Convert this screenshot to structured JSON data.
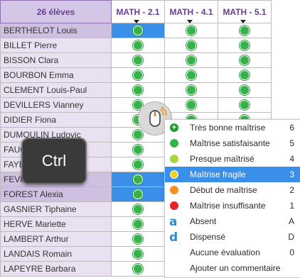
{
  "header": {
    "students_label": "26 élèves",
    "columns": [
      "MATH - 2.1",
      "MATH - 4.1",
      "MATH - 5.1"
    ]
  },
  "students": [
    "BERTHELOT Louis",
    "BILLET Pierre",
    "BISSON Clara",
    "BOURBON Emma",
    "CLEMENT Louis-Paul",
    "DEVILLERS Vianney",
    "DIDIER Fiona",
    "DUMOULIN Ludovic",
    "FAUC",
    "FAYE",
    "FEVR",
    "FOREST Alexia",
    "GASNIER Tiphaine",
    "HERVE Mariette",
    "LAMBERT Arthur",
    "LANDAIS Romain",
    "LAPEYRE Barbara"
  ],
  "context_menu": {
    "items": [
      {
        "label": "Très bonne maîtrise",
        "key": "6",
        "icon": "plus-dark-green-circle-icon"
      },
      {
        "label": "Maîtrise satisfaisante",
        "key": "5",
        "icon": "green-circle-icon"
      },
      {
        "label": "Presque maîtrisé",
        "key": "4",
        "icon": "light-green-circle-icon"
      },
      {
        "label": "Maîtrise fragile",
        "key": "3",
        "icon": "yellow-circle-icon"
      },
      {
        "label": "Début de maîtrise",
        "key": "2",
        "icon": "orange-circle-icon"
      },
      {
        "label": "Maîtrise insuffisante",
        "key": "1",
        "icon": "red-circle-icon"
      },
      {
        "label": "Absent",
        "key": "A",
        "icon": "absent-letter-icon"
      },
      {
        "label": "Dispensé",
        "key": "D",
        "icon": "dispense-letter-icon"
      },
      {
        "label": "Aucune évaluation",
        "key": "0",
        "icon": ""
      },
      {
        "label": "Ajouter un commentaire",
        "key": "",
        "icon": ""
      }
    ],
    "highlighted_index": 3
  },
  "overlays": {
    "ctrl_key_label": "Ctrl"
  },
  "colors": {
    "selection": "#3a8fe8",
    "header_text": "#6a3e94",
    "name_column_bg": "#e9e1f1",
    "assessment_green": "#36b24a"
  }
}
